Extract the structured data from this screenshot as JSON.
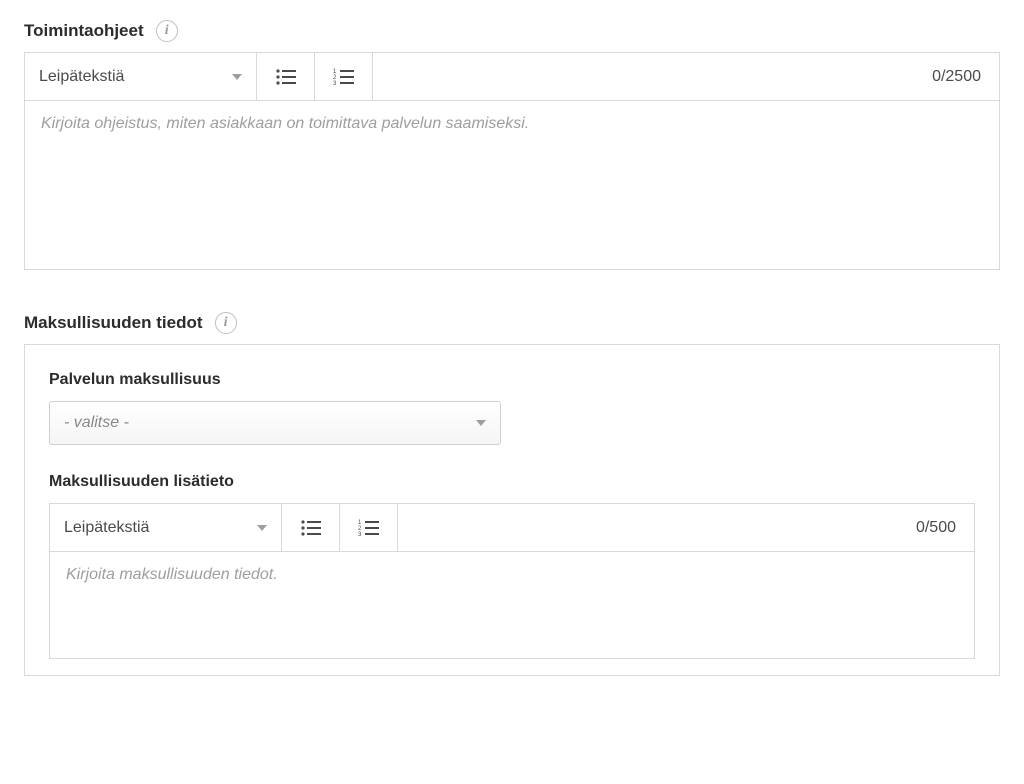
{
  "section1": {
    "title": "Toimintaohjeet",
    "editor": {
      "format_label": "Leipätekstiä",
      "char_count": "0/2500",
      "placeholder": "Kirjoita ohjeistus, miten asiakkaan on toimittava palvelun saamiseksi."
    }
  },
  "section2": {
    "title": "Maksullisuuden tiedot",
    "field1": {
      "label": "Palvelun maksullisuus",
      "selected": "- valitse -"
    },
    "field2": {
      "label": "Maksullisuuden lisätieto",
      "editor": {
        "format_label": "Leipätekstiä",
        "char_count": "0/500",
        "placeholder": "Kirjoita maksullisuuden tiedot."
      }
    }
  }
}
